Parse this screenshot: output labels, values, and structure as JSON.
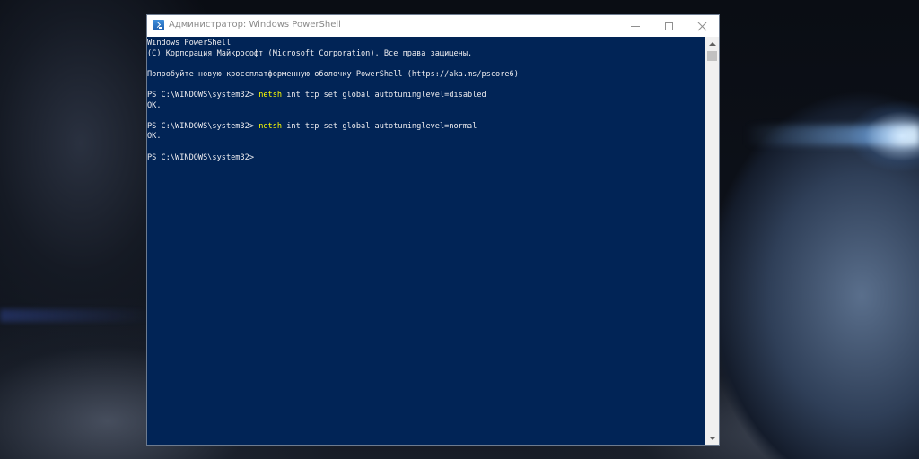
{
  "window": {
    "title": "Администратор: Windows PowerShell",
    "icon": "powershell-icon",
    "controls": {
      "minimize": "minimize-icon",
      "maximize": "maximize-icon",
      "close": "close-icon"
    }
  },
  "console": {
    "background": "#012456",
    "text_color": "#eeedf0",
    "command_color": "#ffff00",
    "lines": [
      {
        "text": "Windows PowerShell"
      },
      {
        "text": "(C) Корпорация Майкрософт (Microsoft Corporation). Все права защищены."
      },
      {
        "text": ""
      },
      {
        "text": "Попробуйте новую кроссплатформенную оболочку PowerShell (https://aka.ms/pscore6)"
      },
      {
        "text": ""
      },
      {
        "prompt": "PS C:\\WINDOWS\\system32> ",
        "command": "netsh",
        "args": " int tcp set global autotuninglevel=disabled"
      },
      {
        "text": "OK."
      },
      {
        "text": ""
      },
      {
        "prompt": "PS C:\\WINDOWS\\system32> ",
        "command": "netsh",
        "args": " int tcp set global autotuninglevel=normal"
      },
      {
        "text": "OK."
      },
      {
        "text": ""
      },
      {
        "prompt": "PS C:\\WINDOWS\\system32>",
        "command": "",
        "args": ""
      }
    ]
  }
}
